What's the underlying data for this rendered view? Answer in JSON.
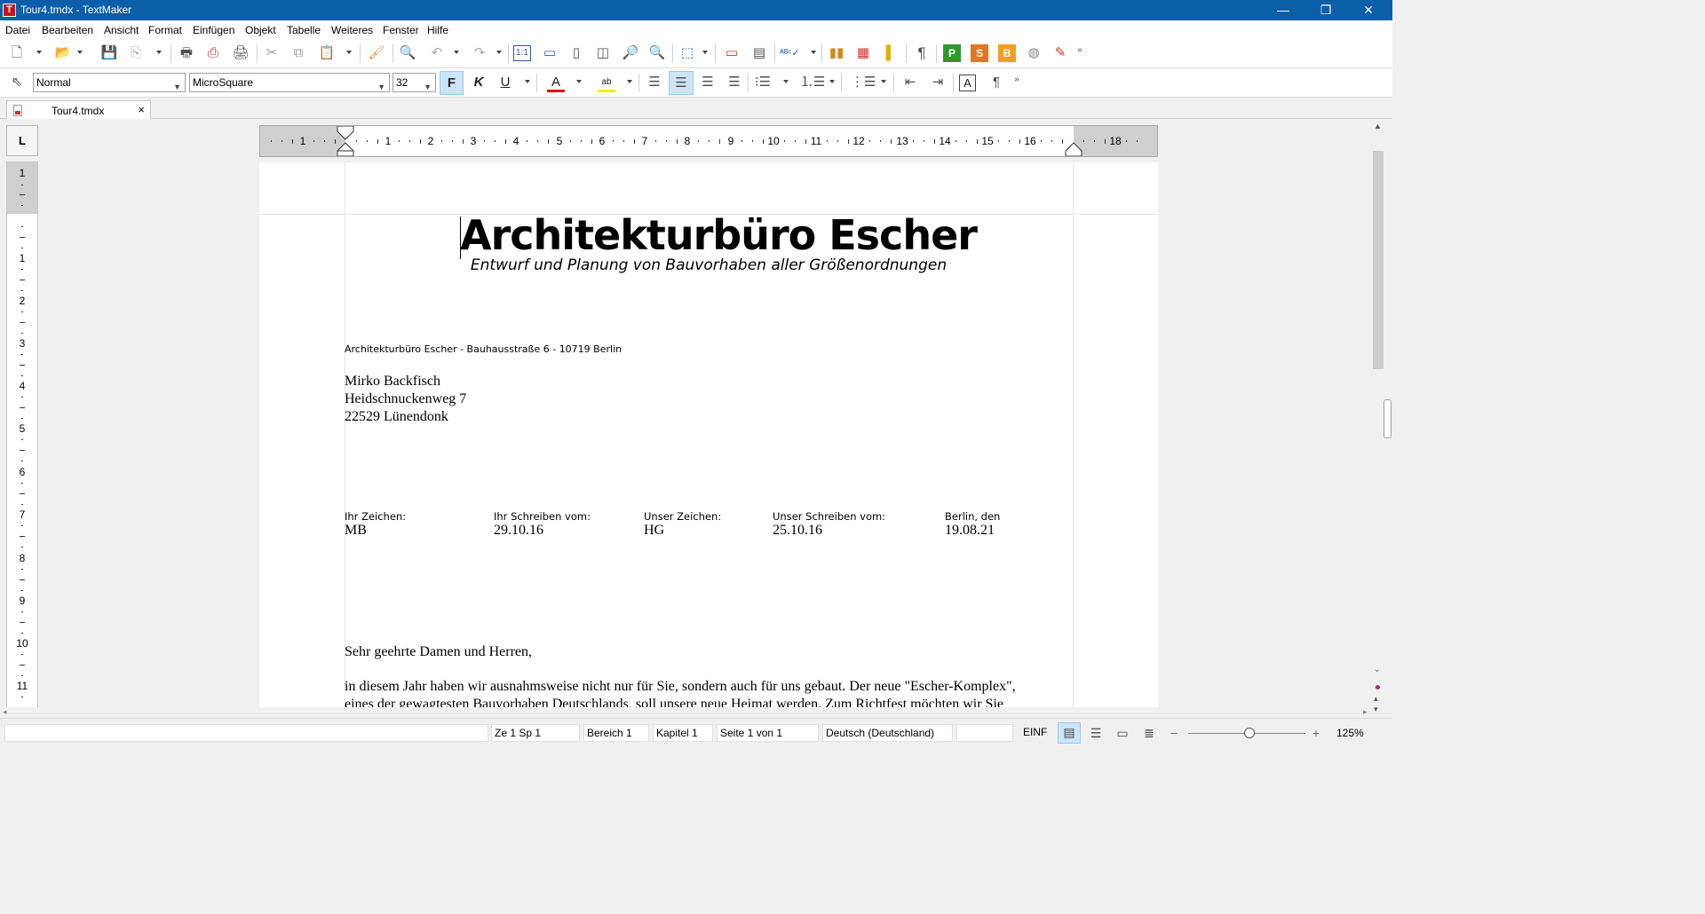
{
  "window": {
    "title": "Tour4.tmdx - TextMaker",
    "app_icon": "T",
    "minimize": "—",
    "restore": "❐",
    "close": "✕"
  },
  "menu": [
    "Datei",
    "Bearbeiten",
    "Ansicht",
    "Format",
    "Einfügen",
    "Objekt",
    "Tabelle",
    "Weiteres",
    "Fenster",
    "Hilfe"
  ],
  "format_bar": {
    "style": "Normal",
    "font": "MicroSquare",
    "size": "32",
    "bold": "F",
    "italic": "K",
    "underline": "U",
    "font_color_letter": "A",
    "highlight_letter": "ab",
    "textframe_letter": "A"
  },
  "tab": {
    "name": "Tour4.tmdx",
    "close": "×"
  },
  "ruler": {
    "corner": "L",
    "h_numbers_left": [
      "1"
    ],
    "h_numbers": [
      "1",
      "2",
      "3",
      "4",
      "5",
      "6",
      "7",
      "8",
      "9",
      "10",
      "11",
      "12",
      "13",
      "14",
      "15",
      "16"
    ],
    "h_number_right": "18",
    "v_top": "1",
    "v_numbers": [
      "1",
      "2",
      "3",
      "4",
      "5",
      "6",
      "7",
      "8",
      "9",
      "10",
      "11"
    ]
  },
  "document": {
    "heading": "Architekturbüro Escher",
    "subheading": "Entwurf und Planung von Bauvorhaben aller Größenordnungen",
    "sender_line": "Architekturbüro Escher - Bauhausstraße 6 - 10719 Berlin",
    "recipient": [
      "Mirko Backfisch",
      "Heidschnuckenweg 7",
      "22529 Lünendonk"
    ],
    "references": [
      {
        "label": "Ihr Zeichen:",
        "value": "MB"
      },
      {
        "label": "Ihr Schreiben vom:",
        "value": "29.10.16"
      },
      {
        "label": "Unser Zeichen:",
        "value": "HG"
      },
      {
        "label": "Unser Schreiben vom:",
        "value": "25.10.16"
      },
      {
        "label": "Berlin, den",
        "value": "19.08.21"
      }
    ],
    "salutation": "Sehr geehrte Damen und Herren,",
    "body_line1": "in diesem Jahr haben wir ausnahmsweise nicht nur für Sie, sondern auch für uns gebaut. Der neue \"Escher-Komplex\",",
    "body_line2": "eines der gewagtesten Bauvorhaben Deutschlands, soll unsere neue Heimat werden. Zum Richtfest möchten wir Sie"
  },
  "status": {
    "blank": "",
    "position": "Ze 1 Sp 1",
    "section": "Bereich 1",
    "chapter": "Kapitel 1",
    "page": "Seite 1 von 1",
    "language": "Deutsch (Deutschland)",
    "mode": "EINF",
    "zoom": "125%",
    "zoom_minus": "−",
    "zoom_plus": "+"
  },
  "colors": {
    "titlebar": "#0a5fa8",
    "active_button": "#cce4f7",
    "font_color_bar": "#e01010",
    "highlight_bar": "#f8f000"
  }
}
